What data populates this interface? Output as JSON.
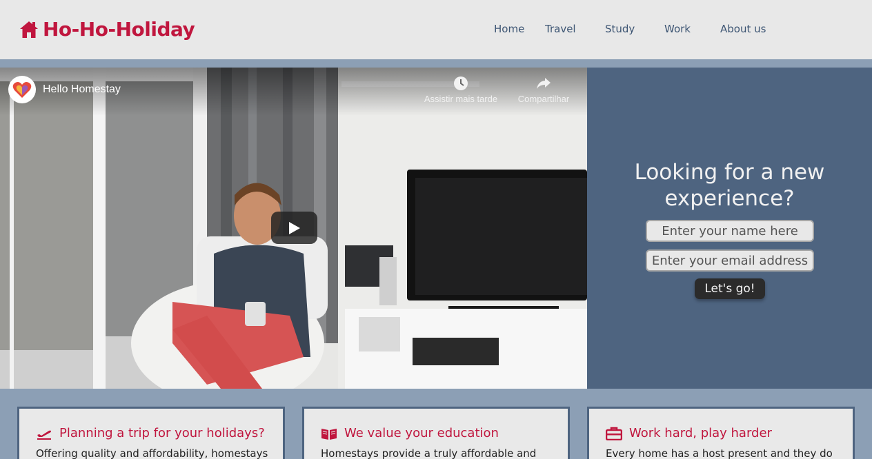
{
  "brand": {
    "name": "Ho-Ho-Holiday",
    "color": "#c0163e"
  },
  "nav": {
    "items": [
      "Home",
      "Travel",
      "Study",
      "Work",
      "About us"
    ]
  },
  "video": {
    "channel_title": "Hello Homestay",
    "watch_later": "Assistir mais tarde",
    "share": "Compartilhar"
  },
  "cta": {
    "title": "Looking for a new experience?",
    "name_placeholder": "Enter your name here",
    "email_placeholder": "Enter your email address",
    "button": "Let's go!"
  },
  "cards": [
    {
      "icon": "plane-departure-icon",
      "title": "Planning a trip for your holidays?",
      "text": "Offering quality and affordability, homestays"
    },
    {
      "icon": "book-icon",
      "title": "We value your education",
      "text": "Homestays provide a truly affordable and"
    },
    {
      "icon": "briefcase-icon",
      "title": "Work hard, play harder",
      "text": "Every home has a host present and they do"
    }
  ],
  "colors": {
    "header_bg": "#e8e8e8",
    "page_bg": "#8c9fb5",
    "cta_bg": "#4e6480",
    "nav_text": "#3d5573"
  }
}
